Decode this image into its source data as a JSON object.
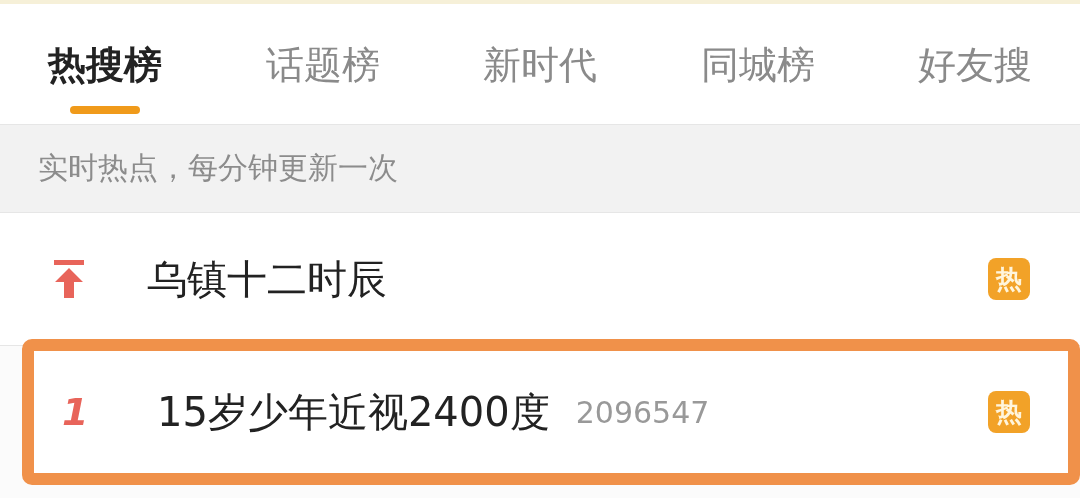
{
  "tabs": [
    {
      "label": "热搜榜",
      "selected": true
    },
    {
      "label": "话题榜",
      "selected": false
    },
    {
      "label": "新时代",
      "selected": false
    },
    {
      "label": "同城榜",
      "selected": false
    },
    {
      "label": "好友搜",
      "selected": false
    }
  ],
  "notice": "实时热点，每分钟更新一次",
  "rows": [
    {
      "kind": "pinned",
      "title": "乌镇十二时辰",
      "badge": "热",
      "highlighted": false
    },
    {
      "kind": "ranked",
      "rank": "1",
      "title": "15岁少年近视2400度",
      "count": "2096547",
      "badge": "热",
      "highlighted": true
    }
  ]
}
